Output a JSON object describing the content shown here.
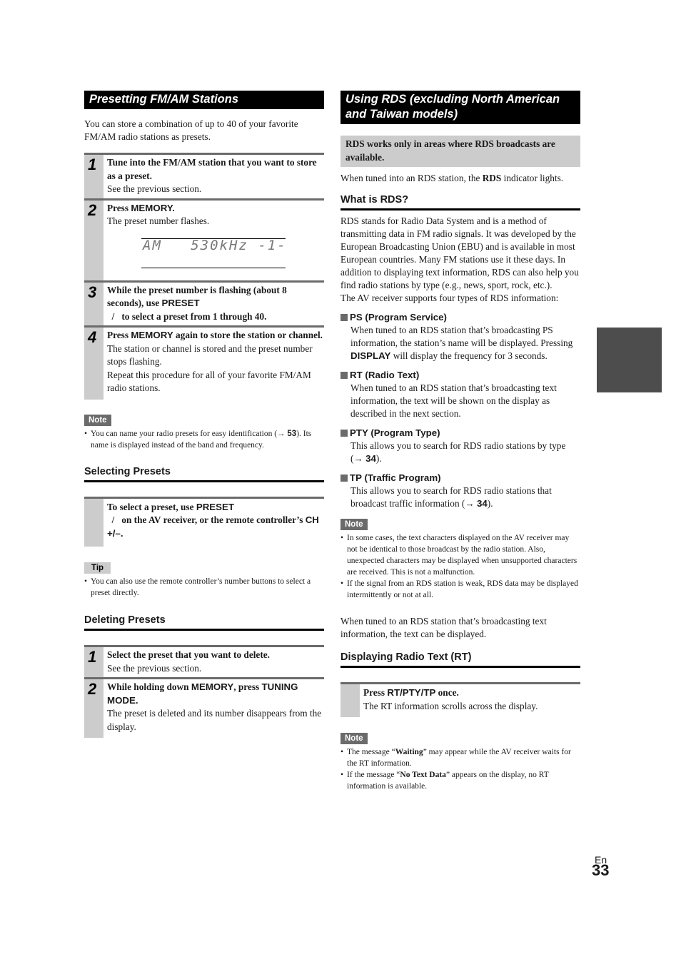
{
  "left": {
    "preset_section": {
      "title": "Presetting FM/AM Stations",
      "intro": "You can store a combination of up to 40 of your favorite FM/AM radio stations as presets.",
      "steps": [
        {
          "num": "1",
          "bold": "Tune into the FM/AM station that you want to store as a preset.",
          "text": "See the previous section."
        },
        {
          "num": "2",
          "bold_pre": "Press ",
          "kw": "MEMORY.",
          "text": "The preset number flashes.",
          "display": {
            "band": "AM",
            "freq": "530kHz",
            "preset": "1"
          }
        },
        {
          "num": "3",
          "bold_pre": "While the preset number is flashing (about 8 seconds), use ",
          "kw": "PRESET",
          "bold_post": "  /   to select a preset from 1 through 40."
        },
        {
          "num": "4",
          "bold_pre": "Press ",
          "kw": "MEMORY",
          "bold_post": " again to store the station or channel.",
          "text1": "The station or channel is stored and the preset number stops flashing.",
          "text2": "Repeat this procedure for all of your favorite FM/AM radio stations."
        }
      ],
      "note_label": "Note",
      "note_pre": "You can name your radio presets for easy identification (→ ",
      "note_ref": "53",
      "note_post": "). Its name is displayed instead of the band and frequency."
    },
    "selecting": {
      "title": "Selecting Presets",
      "bold_pre": "To select a preset, use ",
      "kw1": "PRESET",
      "bold_mid": "  /   on the AV receiver, or the remote controller’s ",
      "kw2": "CH +/–.",
      "tip_label": "Tip",
      "tip": "You can also use the remote controller’s number buttons to select a preset directly."
    },
    "deleting": {
      "title": "Deleting Presets",
      "steps": [
        {
          "num": "1",
          "bold": "Select the preset that you want to delete.",
          "text": "See the previous section."
        },
        {
          "num": "2",
          "bold_pre": "While holding down ",
          "kw1": "MEMORY",
          "bold_mid": ", press ",
          "kw2": "TUNING MODE.",
          "text": "The preset is deleted and its number disappears from the display."
        }
      ]
    }
  },
  "right": {
    "title": "Using RDS (excluding North American and Taiwan models)",
    "warning": "RDS works only in areas where RDS broadcasts are available.",
    "indicator_pre": "When tuned into an RDS station, the ",
    "indicator_bold": "RDS",
    "indicator_post": " indicator lights.",
    "what_is": {
      "title": "What is RDS?",
      "para1": "RDS stands for Radio Data System and is a method of transmitting data in FM radio signals. It was developed by the European Broadcasting Union (EBU) and is available in most European countries. Many FM stations use it these days. In addition to displaying text information, RDS can also help you find radio stations by type (e.g., news, sport, rock, etc.).",
      "para2": "The AV receiver supports four types of RDS information:",
      "types": [
        {
          "title": "PS (Program Service)",
          "pre": "When tuned to an RDS station that’s broadcasting PS information, the station’s name will be displayed. Pressing ",
          "kw": "DISPLAY",
          "post": " will display the frequency for 3 seconds."
        },
        {
          "title": "RT (Radio Text)",
          "pre": "When tuned to an RDS station that’s broadcasting text information, the text will be shown on the display as described in the next section.",
          "kw": "",
          "post": ""
        },
        {
          "title": "PTY (Program Type)",
          "pre": "This allows you to search for RDS radio stations by type (→ ",
          "kw": "34",
          "post": ")."
        },
        {
          "title": "TP (Traffic Program)",
          "pre": "This allows you to search for RDS radio stations that broadcast traffic information (→ ",
          "kw": "34",
          "post": ")."
        }
      ],
      "note_label": "Note",
      "notes": [
        "In some cases, the text characters displayed on the AV receiver may not be identical to those broadcast by the radio station. Also, unexpected characters may be displayed when unsupported characters are received. This is not a malfunction.",
        "If the signal from an RDS station is weak, RDS data may be displayed intermittently or not at all."
      ],
      "closing": "When tuned to an RDS station that’s broadcasting text information, the text can be displayed."
    },
    "rt": {
      "title": "Displaying Radio Text (RT)",
      "bold_pre": "Press ",
      "kw": "RT/PTY/TP",
      "bold_post": " once.",
      "text": "The RT information scrolls across the display.",
      "note_label": "Note",
      "note1_pre": "The message “",
      "note1_bold": "Waiting",
      "note1_post": "” may appear while the AV receiver waits for the RT information.",
      "note2_pre": "If the message “",
      "note2_bold": "No Text Data",
      "note2_post": "” appears on the display, no RT information is available."
    }
  },
  "footer": {
    "lang": "En",
    "page": "33"
  }
}
